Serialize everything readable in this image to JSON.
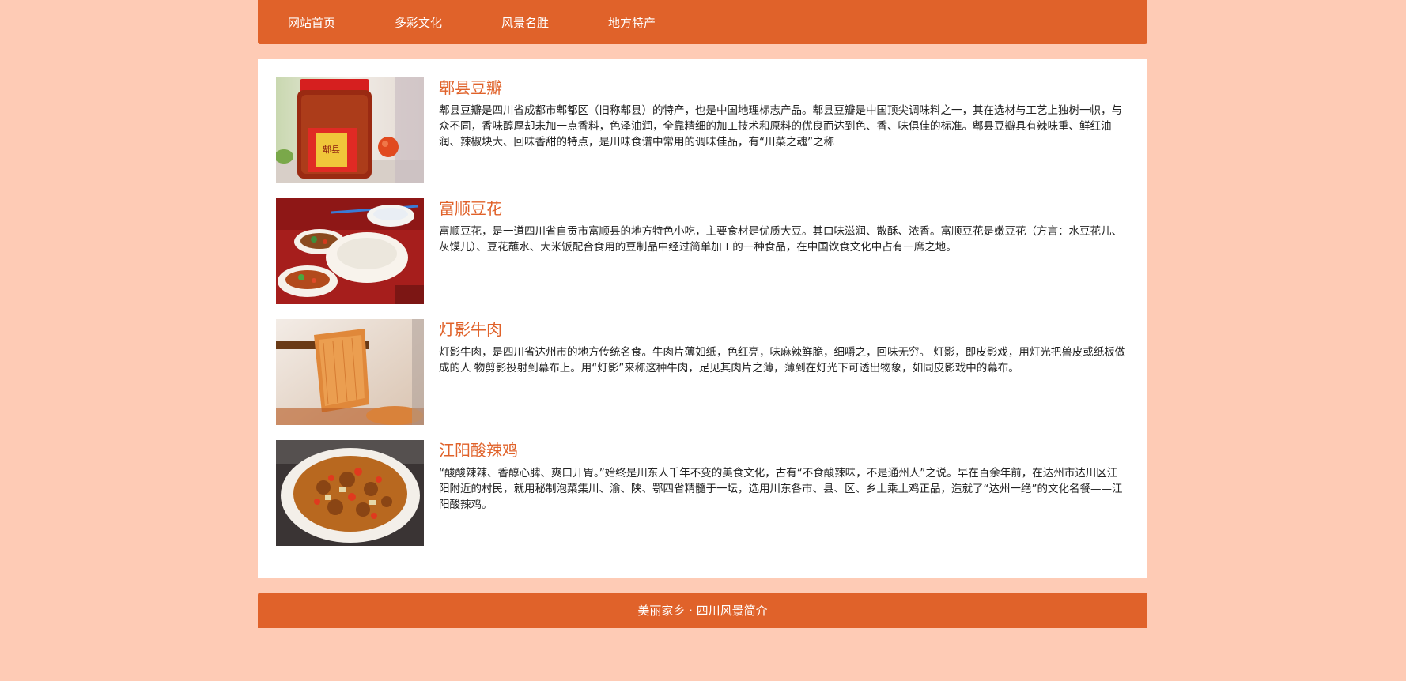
{
  "nav": {
    "items": [
      "网站首页",
      "多彩文化",
      "风景名胜",
      "地方特产"
    ]
  },
  "products": [
    {
      "title": "郫县豆瓣",
      "desc": "郫县豆瓣是四川省成都市郫都区（旧称郫县）的特产，也是中国地理标志产品。郫县豆瓣是中国顶尖调味料之一，其在选材与工艺上独树一帜，与众不同，香味醇厚却未加一点香料，色泽油润，全靠精细的加工技术和原料的优良而达到色、香、味俱佳的标准。郫县豆瓣具有辣味重、鲜红油润、辣椒块大、回味香甜的特点，是川味食谱中常用的调味佳品，有“川菜之魂”之称"
    },
    {
      "title": "富顺豆花",
      "desc": "富顺豆花，是一道四川省自贡市富顺县的地方特色小吃，主要食材是优质大豆。其口味滋润、散酥、浓香。富顺豆花是嫩豆花（方言：水豆花儿、灰馍儿）、豆花蘸水、大米饭配合食用的豆制品中经过简单加工的一种食品，在中国饮食文化中占有一席之地。"
    },
    {
      "title": "灯影牛肉",
      "desc": "灯影牛肉，是四川省达州市的地方传统名食。牛肉片薄如纸，色红亮，味麻辣鲜脆，细嚼之，回味无穷。 灯影，即皮影戏，用灯光把兽皮或纸板做成的人 物剪影投射到幕布上。用“灯影”来称这种牛肉，足见其肉片之薄，薄到在灯光下可透出物象，如同皮影戏中的幕布。"
    },
    {
      "title": "江阳酸辣鸡",
      "desc": "“酸酸辣辣、香醇心脾、爽口开胃。”始终是川东人千年不变的美食文化，古有“不食酸辣味，不是通州人”之说。早在百余年前，在达州市达川区江阳附近的村民，就用秘制泡菜集川、渝、陕、鄂四省精髓于一坛，选用川东各市、县、区、乡上乘土鸡正品，造就了“达州一绝”的文化名餐——江阳酸辣鸡。"
    }
  ],
  "footer": {
    "text": "美丽家乡 · 四川风景简介"
  },
  "colors": {
    "accent": "#e0622a",
    "background": "#fecbb5"
  }
}
